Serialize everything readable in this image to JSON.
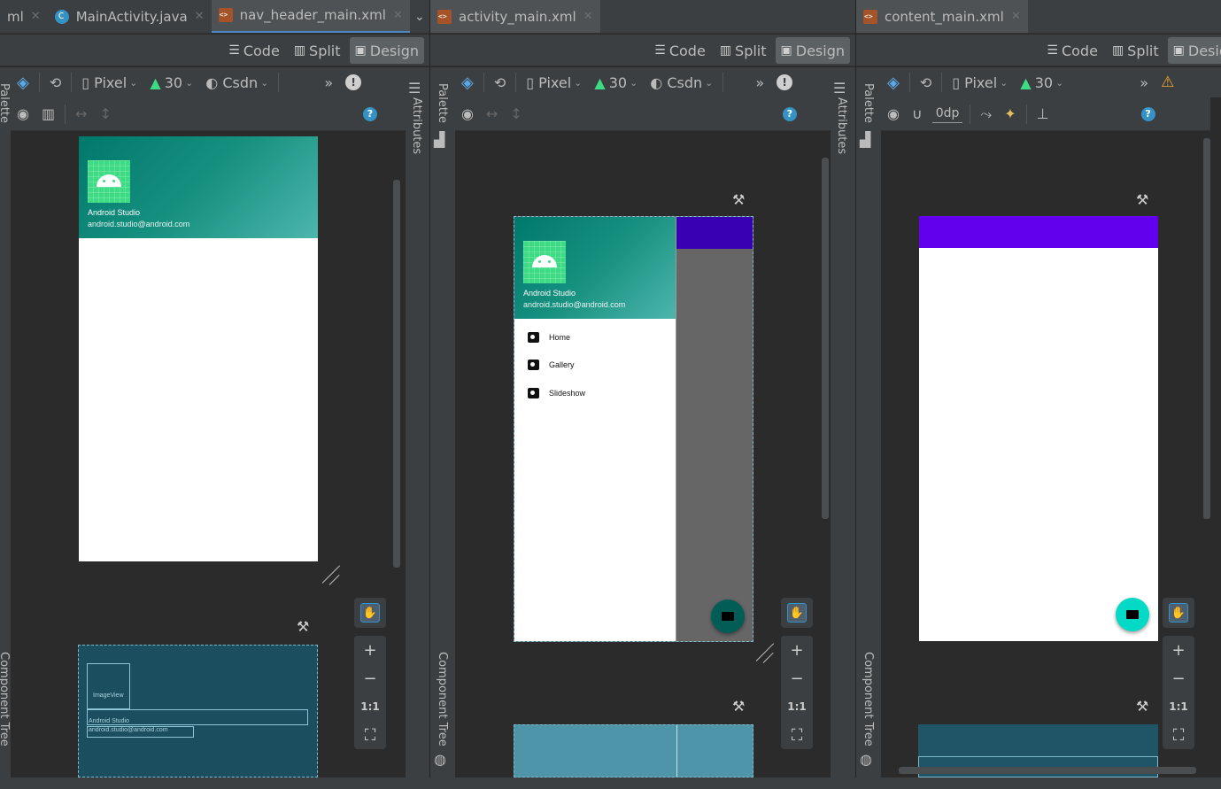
{
  "panes": [
    {
      "tabs": [
        {
          "label": "ml",
          "icon": "none"
        },
        {
          "label": "MainActivity.java",
          "icon": "java-file-icon"
        },
        {
          "label": "nav_header_main.xml",
          "icon": "xml-file-icon",
          "active": true
        }
      ],
      "toolbar": {
        "device": "Pixel",
        "api": "30",
        "theme": "Csdn"
      }
    },
    {
      "tabs": [
        {
          "label": "activity_main.xml",
          "icon": "xml-file-icon",
          "active": true
        }
      ],
      "toolbar": {
        "device": "Pixel",
        "api": "30",
        "theme": "Csdn"
      }
    },
    {
      "tabs": [
        {
          "label": "content_main.xml",
          "icon": "xml-file-icon",
          "active": true
        }
      ],
      "toolbar": {
        "device": "Pixel",
        "api": "30",
        "margin": "0dp"
      }
    }
  ],
  "modes": {
    "code": "Code",
    "split": "Split",
    "design": "Design",
    "design_cut": "Desig"
  },
  "side": {
    "palette": "Palette",
    "attributes": "Attributes",
    "component_tree": "Component Tree"
  },
  "header": {
    "name": "Android Studio",
    "email": "android.studio@android.com"
  },
  "menu": [
    {
      "label": "Home",
      "icon": "camera-icon"
    },
    {
      "label": "Gallery",
      "icon": "image-icon"
    },
    {
      "label": "Slideshow",
      "icon": "slideshow-icon"
    }
  ],
  "blueprint": {
    "image": "ImageView",
    "name": "Android Studio",
    "email": "android.studio@android.com"
  },
  "zoom": {
    "plus": "+",
    "minus": "−",
    "one": "1:1"
  },
  "colors": {
    "primary": "#6200ee",
    "primary_dark": "#3700b3",
    "fab": "#03dac5",
    "fab_dark": "#015d55"
  }
}
